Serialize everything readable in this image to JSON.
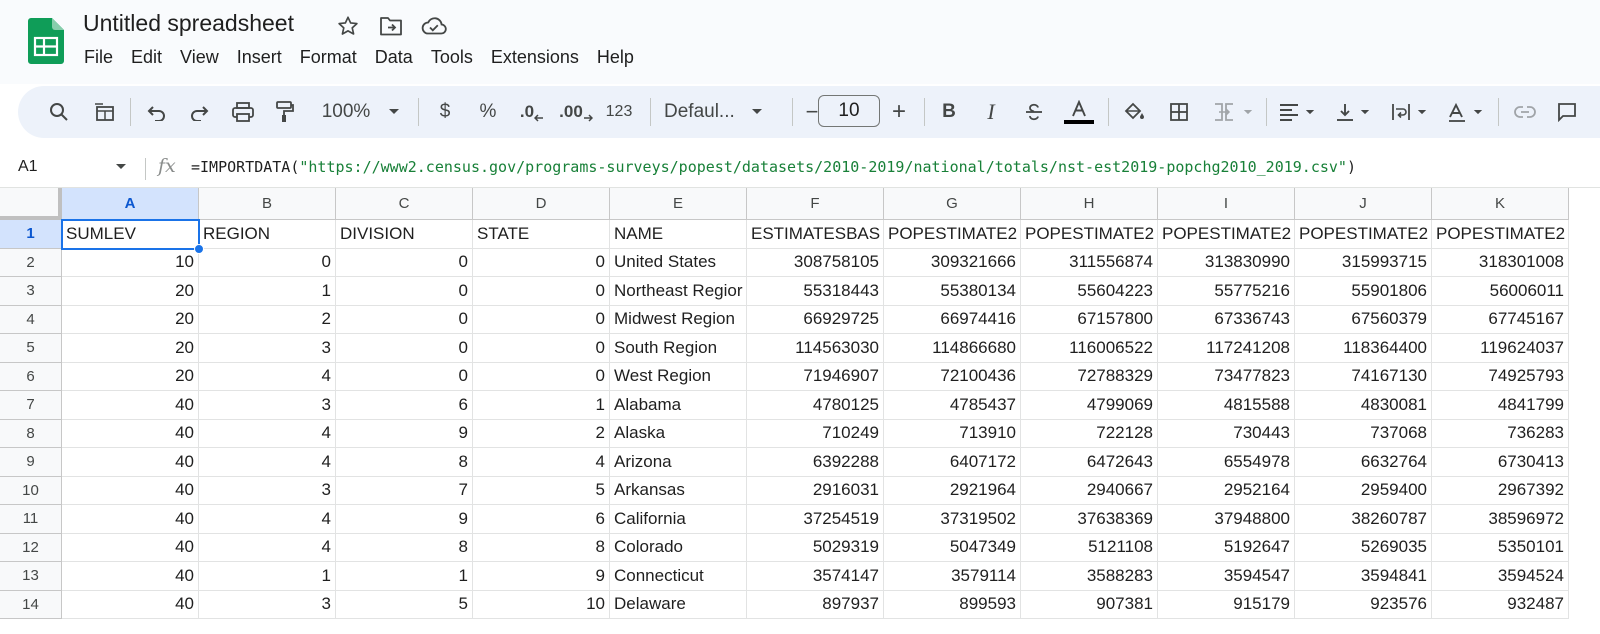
{
  "app": {
    "doc_title": "Untitled spreadsheet",
    "brand_color": "#0f9d58",
    "accent_color": "#1a73e8"
  },
  "title_icons": [
    "star-icon",
    "move-to-folder-icon",
    "cloud-saved-icon"
  ],
  "menu": [
    "File",
    "Edit",
    "View",
    "Insert",
    "Format",
    "Data",
    "Tools",
    "Extensions",
    "Help"
  ],
  "toolbar": {
    "icons": [
      "search-icon",
      "menus-icon",
      "undo-icon",
      "redo-icon",
      "print-icon",
      "paint-format-icon"
    ],
    "zoom": "100%",
    "currency_label": "$",
    "percent_label": "%",
    "decrease_decimal_label": ".0",
    "increase_decimal_label": ".00",
    "more_formats_label": "123",
    "font_name": "Defaul...",
    "font_size": "10",
    "minus_label": "−",
    "plus_label": "+",
    "text_color": "#000000"
  },
  "formula_bar": {
    "name_box": "A1",
    "fx": "fx",
    "formula_prefix": "=IMPORTDATA(",
    "formula_string": "\"https://www2.census.gov/programs-surveys/popest/datasets/2010-2019/national/totals/nst-est2019-popchg2010_2019.csv\"",
    "formula_suffix": ")"
  },
  "sheet": {
    "columns": [
      "A",
      "B",
      "C",
      "D",
      "E",
      "F",
      "G",
      "H",
      "I",
      "J",
      "K"
    ],
    "active_column": "A",
    "active_row": "1",
    "row_numbers": [
      "1",
      "2",
      "3",
      "4",
      "5",
      "6",
      "7",
      "8",
      "9",
      "10",
      "11",
      "12",
      "13",
      "14"
    ],
    "rows": [
      [
        "SUMLEV",
        "REGION",
        "DIVISION",
        "STATE",
        "NAME",
        "ESTIMATESBAS",
        "POPESTIMATE2",
        "POPESTIMATE2",
        "POPESTIMATE2",
        "POPESTIMATE2",
        "POPESTIMATE2"
      ],
      [
        "10",
        "0",
        "0",
        "0",
        "United States",
        "308758105",
        "309321666",
        "311556874",
        "313830990",
        "315993715",
        "318301008"
      ],
      [
        "20",
        "1",
        "0",
        "0",
        "Northeast Regior",
        "55318443",
        "55380134",
        "55604223",
        "55775216",
        "55901806",
        "56006011"
      ],
      [
        "20",
        "2",
        "0",
        "0",
        "Midwest Region",
        "66929725",
        "66974416",
        "67157800",
        "67336743",
        "67560379",
        "67745167"
      ],
      [
        "20",
        "3",
        "0",
        "0",
        "South Region",
        "114563030",
        "114866680",
        "116006522",
        "117241208",
        "118364400",
        "119624037"
      ],
      [
        "20",
        "4",
        "0",
        "0",
        "West Region",
        "71946907",
        "72100436",
        "72788329",
        "73477823",
        "74167130",
        "74925793"
      ],
      [
        "40",
        "3",
        "6",
        "1",
        "Alabama",
        "4780125",
        "4785437",
        "4799069",
        "4815588",
        "4830081",
        "4841799"
      ],
      [
        "40",
        "4",
        "9",
        "2",
        "Alaska",
        "710249",
        "713910",
        "722128",
        "730443",
        "737068",
        "736283"
      ],
      [
        "40",
        "4",
        "8",
        "4",
        "Arizona",
        "6392288",
        "6407172",
        "6472643",
        "6554978",
        "6632764",
        "6730413"
      ],
      [
        "40",
        "3",
        "7",
        "5",
        "Arkansas",
        "2916031",
        "2921964",
        "2940667",
        "2952164",
        "2959400",
        "2967392"
      ],
      [
        "40",
        "4",
        "9",
        "6",
        "California",
        "37254519",
        "37319502",
        "37638369",
        "37948800",
        "38260787",
        "38596972"
      ],
      [
        "40",
        "4",
        "8",
        "8",
        "Colorado",
        "5029319",
        "5047349",
        "5121108",
        "5192647",
        "5269035",
        "5350101"
      ],
      [
        "40",
        "1",
        "1",
        "9",
        "Connecticut",
        "3574147",
        "3579114",
        "3588283",
        "3594547",
        "3594841",
        "3594524"
      ],
      [
        "40",
        "3",
        "5",
        "10",
        "Delaware",
        "897937",
        "899593",
        "907381",
        "915179",
        "923576",
        "932487"
      ]
    ]
  }
}
